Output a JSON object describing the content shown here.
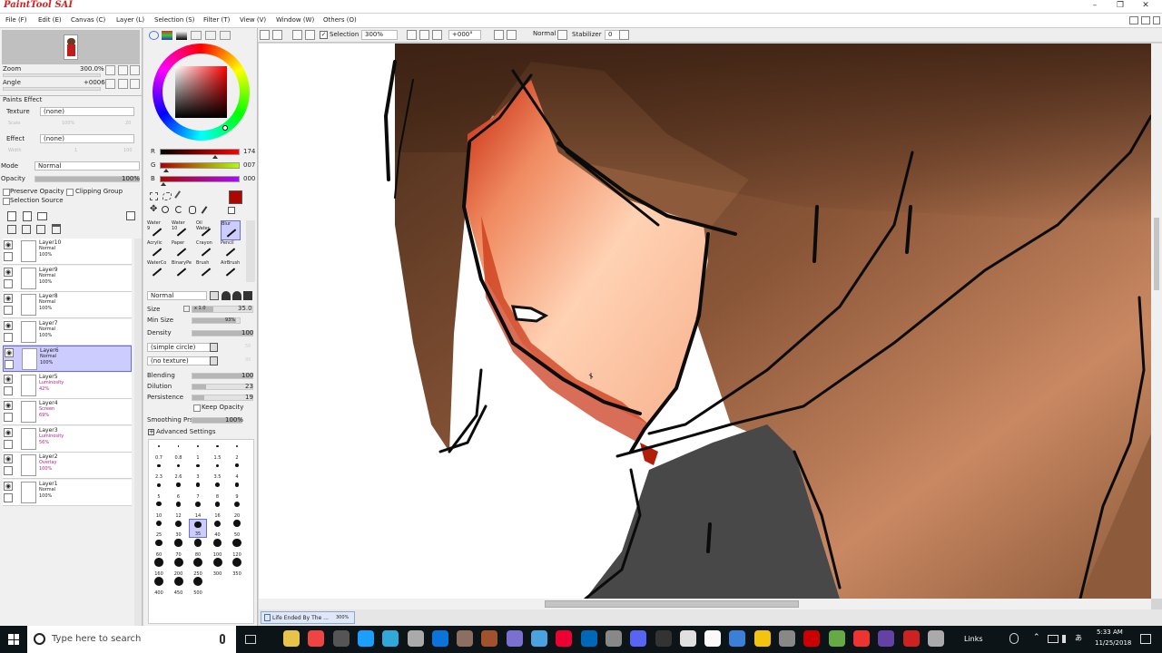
{
  "app": {
    "logo": "PaintTool SAI",
    "title": ""
  },
  "menu": [
    "File (F)",
    "Edit (E)",
    "Canvas (C)",
    "Layer (L)",
    "Selection (S)",
    "Filter (T)",
    "View (V)",
    "Window (W)",
    "Others (O)"
  ],
  "toolbar": {
    "selection_label": "Selection",
    "zoom": "300%",
    "angle": "+000°",
    "blend": "Normal",
    "stabilizer_label": "Stabilizer",
    "stabilizer": "0"
  },
  "navigator": {
    "zoom_label": "Zoom",
    "zoom_value": "300.0%",
    "angle_label": "Angle",
    "angle_value": "+0006"
  },
  "paints_effect": {
    "header": "Paints Effect",
    "texture_label": "Texture",
    "texture_value": "(none)",
    "scale_label": "Scale",
    "scale_value": "100%",
    "scale_num": "20",
    "effect_label": "Effect",
    "effect_value": "(none)",
    "width_label": "Width",
    "width_value": "1",
    "width_num": "100"
  },
  "layer_props": {
    "mode_label": "Mode",
    "mode_value": "Normal",
    "opacity_label": "Opacity",
    "opacity_value": "100%",
    "preserve_opacity": "Preserve Opacity",
    "clipping_group": "Clipping Group",
    "selection_source": "Selection Source"
  },
  "layers": [
    {
      "name": "Layer10",
      "mode": "Normal",
      "opacity": "100%"
    },
    {
      "name": "Layer9",
      "mode": "Normal",
      "opacity": "100%"
    },
    {
      "name": "Layer8",
      "mode": "Normal",
      "opacity": "100%"
    },
    {
      "name": "Layer7",
      "mode": "Normal",
      "opacity": "100%"
    },
    {
      "name": "Layer6",
      "mode": "Normal",
      "opacity": "100%"
    },
    {
      "name": "Layer5",
      "mode": "Luminosity",
      "opacity": "42%"
    },
    {
      "name": "Layer4",
      "mode": "Screen",
      "opacity": "69%"
    },
    {
      "name": "Layer3",
      "mode": "Luminosity",
      "opacity": "56%"
    },
    {
      "name": "Layer2",
      "mode": "Overlay",
      "opacity": "100%"
    },
    {
      "name": "Layer1",
      "mode": "Normal",
      "opacity": "100%"
    }
  ],
  "color": {
    "r_label": "R",
    "g_label": "G",
    "b_label": "B",
    "r": "174",
    "g": "007",
    "b": "000",
    "r_frac": 0.68,
    "g_frac": 0.03,
    "b_frac": 0.0,
    "current": "#ae0700"
  },
  "tools": [
    {
      "name": "Water",
      "num": "9"
    },
    {
      "name": "Water",
      "num": "10"
    },
    {
      "name": "Oil Water",
      "num": ""
    },
    {
      "name": "Blur",
      "num": ""
    },
    {
      "name": "Acrylic",
      "num": ""
    },
    {
      "name": "Paper",
      "num": ""
    },
    {
      "name": "Crayon",
      "num": ""
    },
    {
      "name": "Pencil",
      "num": ""
    },
    {
      "name": "WaterCo",
      "num": ""
    },
    {
      "name": "BinaryPe",
      "num": ""
    },
    {
      "name": "Brush",
      "num": ""
    },
    {
      "name": "AirBrush",
      "num": ""
    }
  ],
  "brush": {
    "blend_mode": "Normal",
    "size_label": "Size",
    "size_mult": "x 1.0",
    "size_value": "35.0",
    "minsize_label": "Min Size",
    "minsize_value": "93%",
    "minsize_frac": 0.93,
    "density_label": "Density",
    "density_value": "100",
    "density_frac": 1.0,
    "shape": "(simple circle)",
    "shape_num": "50",
    "texture": "(no texture)",
    "texture_num": "95",
    "blending_label": "Blending",
    "blending_value": "100",
    "blending_frac": 1.0,
    "dilution_label": "Dilution",
    "dilution_value": "23",
    "dilution_frac": 0.23,
    "persistence_label": "Persistence",
    "persistence_value": "19",
    "persistence_frac": 0.19,
    "keep_opacity": "Keep Opacity",
    "smoothing_label": "Smoothing Prs",
    "smoothing_value": "100%",
    "smoothing_frac": 1.0,
    "advanced": "Advanced Settings"
  },
  "brush_sizes": [
    "0.7",
    "0.8",
    "1",
    "1.5",
    "2",
    "2.3",
    "2.6",
    "3",
    "3.5",
    "4",
    "5",
    "6",
    "7",
    "8",
    "9",
    "10",
    "12",
    "14",
    "16",
    "20",
    "25",
    "30",
    "35",
    "40",
    "50",
    "60",
    "70",
    "80",
    "100",
    "120",
    "160",
    "200",
    "250",
    "300",
    "350",
    "400",
    "450",
    "500"
  ],
  "selected_brush_size": "35",
  "document_tab": {
    "name": "Life Ended By The ...",
    "zoom": "300%"
  },
  "taskbar": {
    "search_placeholder": "Type here to search",
    "links_label": "Links",
    "time": "5:33 AM",
    "date": "11/25/2018",
    "icon_colors": [
      "#e8c34a",
      "#e44",
      "#555",
      "#1a9fff",
      "#31a9d8",
      "#aaa",
      "#0a74da",
      "#8d6e63",
      "#a0522d",
      "#7b6fd0",
      "#4aa3df",
      "#e03",
      "#0068b8",
      "#888",
      "#5865f2",
      "#333",
      "#e0e0e0",
      "#fafafa",
      "#3a7fd8",
      "#f2c40f",
      "#888",
      "#c00",
      "#6a4",
      "#e33",
      "#6441a5",
      "#cc2222",
      "#aaa"
    ]
  }
}
